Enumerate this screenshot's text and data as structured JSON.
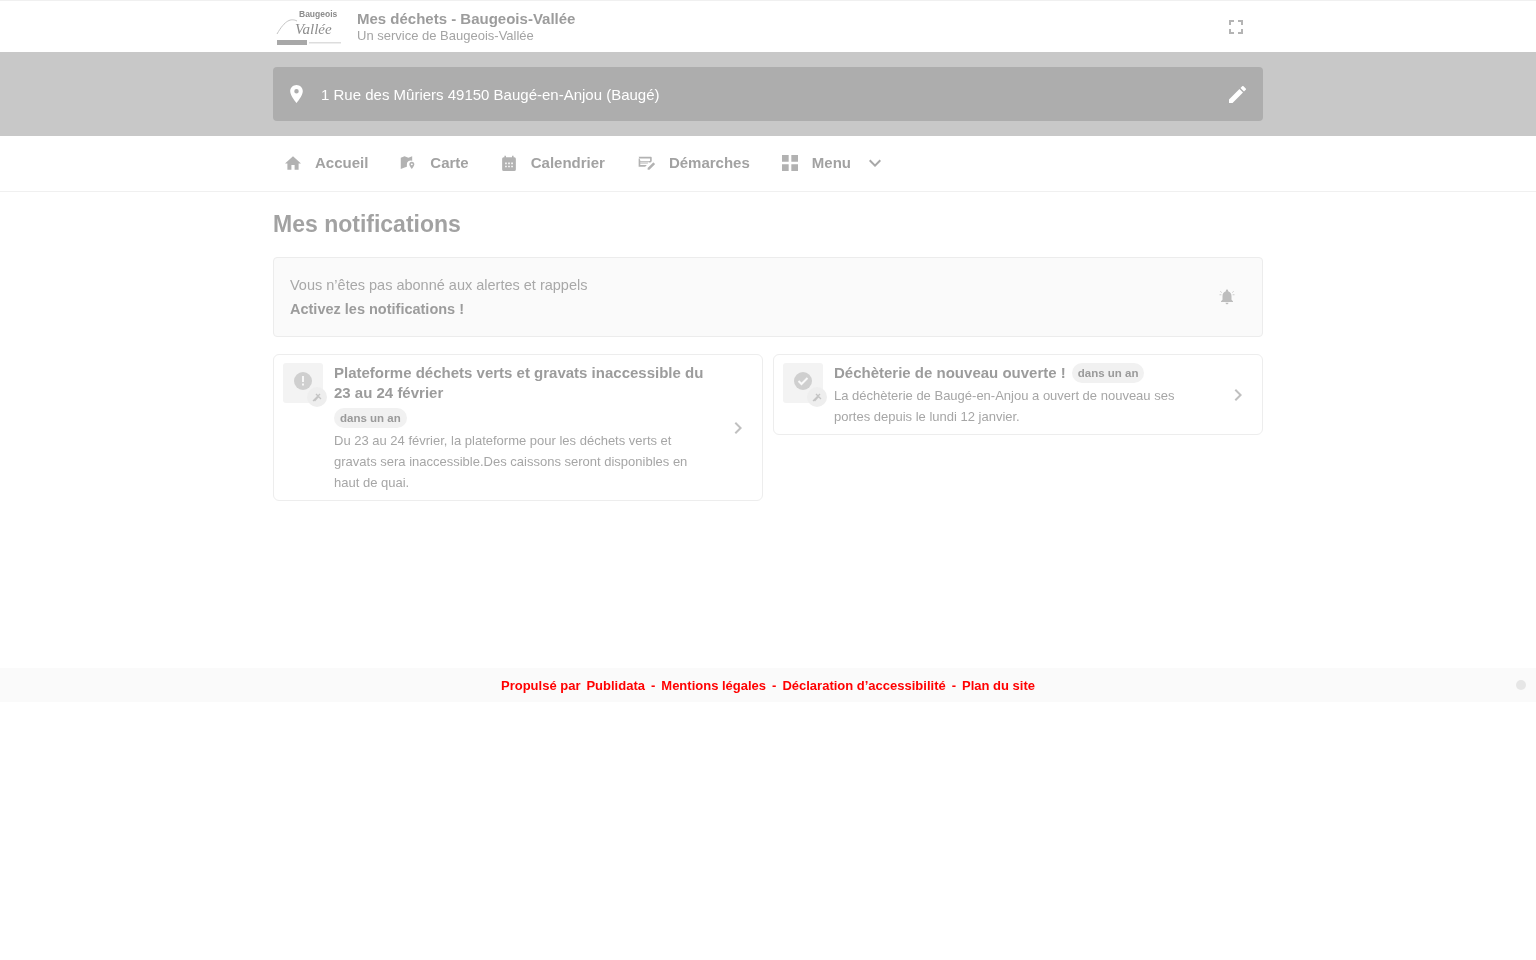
{
  "header": {
    "logo": {
      "line_1": "Baugeois",
      "line_2": "Vallée"
    },
    "title": "Mes déchets - Baugeois-Vallée",
    "subtitle": "Un service de Baugeois-Vallée"
  },
  "address": {
    "text": "1 Rue des Mûriers 49150 Baugé-en-Anjou (Baugé)"
  },
  "nav": {
    "items": [
      {
        "label": "Accueil",
        "selected": false
      },
      {
        "label": "Carte",
        "selected": false
      },
      {
        "label": "Calendrier",
        "selected": false
      },
      {
        "label": "Démarches",
        "selected": false
      },
      {
        "label": "Menu",
        "selected": false,
        "expanded": false
      }
    ]
  },
  "notifications_section": {
    "heading": "Mes notifications",
    "alert": {
      "message": "Vous n’êtes pas abonné aux alertes et rappels",
      "action": "Activez les notifications !"
    },
    "items": [
      {
        "kind": "warning",
        "title": "Plateforme déchets verts et gravats inaccessible du 23 au 24 février",
        "tag": "dans un an",
        "body": "Du 23 au 24 février, la plateforme pour les déchets verts et gravats sera inaccessible.Des caissons seront disponibles en haut de quai."
      },
      {
        "kind": "success",
        "title": "Déchèterie de nouveau ouverte !",
        "tag": "dans un an",
        "body": "La déchèterie de Baugé-en-Anjou a ouvert de nouveau ses portes depuis le lundi 12 janvier."
      }
    ]
  },
  "footer": {
    "powered_by": "Propulsé par",
    "provider": "Publidata",
    "separator": "-",
    "links": [
      "Mentions légales",
      "Déclaration d’accessibilité",
      "Plan du site"
    ]
  }
}
